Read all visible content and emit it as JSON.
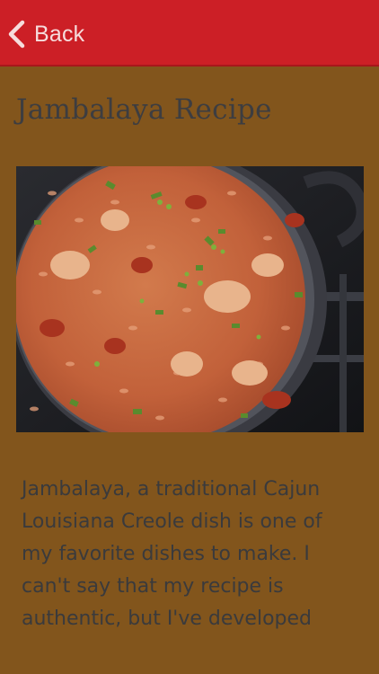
{
  "nav": {
    "back_label": "Back"
  },
  "recipe": {
    "title": "Jambalaya Recipe",
    "image_alt_icon": "jambalaya-photo",
    "description_lines": [
      "Jambalaya, a traditional Cajun",
      "Louisiana Creole dish is one of",
      "my favorite dishes to make. I",
      "can't say that my recipe is",
      "authentic, but I've developed"
    ]
  },
  "colors": {
    "nav_bar": "#cc1f26",
    "page_background": "#82551c",
    "title_text": "#3d3d40",
    "body_text": "#3a3a3c"
  }
}
